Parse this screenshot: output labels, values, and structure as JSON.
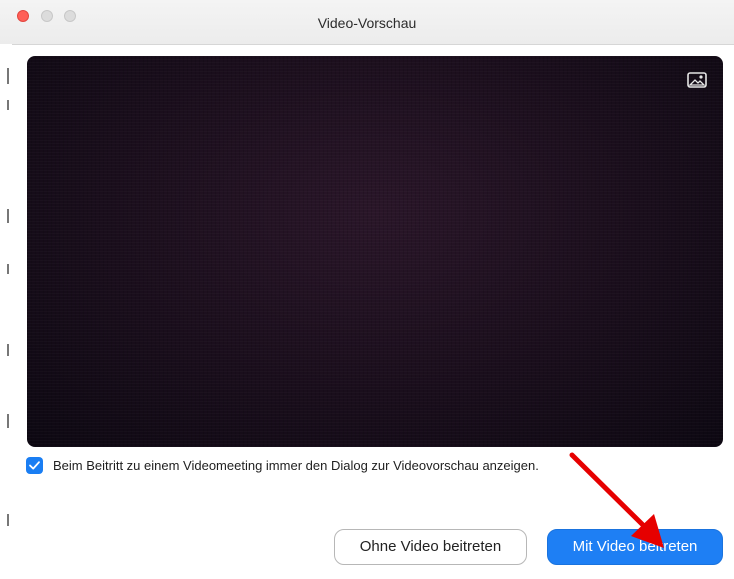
{
  "window": {
    "title": "Video-Vorschau",
    "traffic_lights": [
      "close",
      "minimize",
      "zoom"
    ]
  },
  "video_preview": {
    "background_icon": "virtual-background-icon"
  },
  "preference": {
    "checked": true,
    "label": "Beim Beitritt zu einem Videomeeting immer den Dialog zur Videovorschau anzeigen."
  },
  "buttons": {
    "without_video": "Ohne Video beitreten",
    "with_video": "Mit Video beitreten"
  },
  "colors": {
    "accent": "#1e7ff4",
    "close": "#ff5f57",
    "annotation_arrow": "#e60000"
  }
}
